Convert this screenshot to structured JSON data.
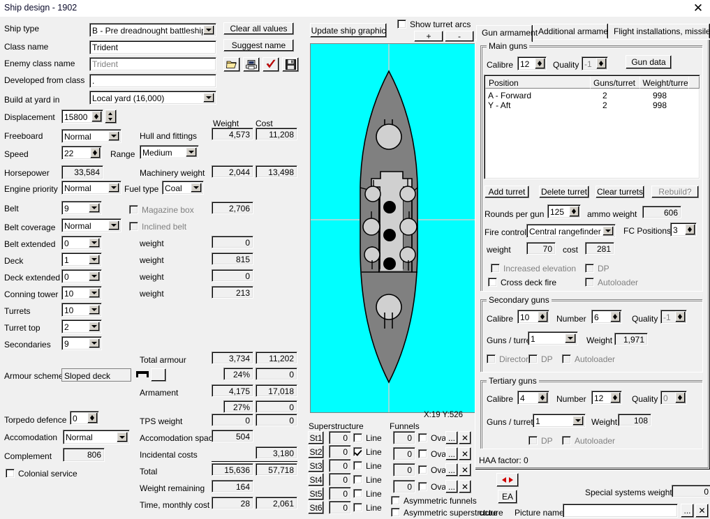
{
  "window": {
    "title": "Ship design - 1902",
    "close_label": "✕"
  },
  "left": {
    "fields": [
      {
        "label": "Ship type",
        "value": "B - Pre dreadnought battleship",
        "kind": "combo"
      },
      {
        "label": "Class name",
        "value": "Trident",
        "kind": "text"
      },
      {
        "label": "Enemy class name",
        "value": "Trident",
        "kind": "text-gray"
      },
      {
        "label": "Developed from class",
        "value": ".",
        "kind": "text"
      },
      {
        "label": "Build at yard in",
        "value": "Local yard (16,000)",
        "kind": "combo"
      },
      {
        "label": "Displacement",
        "value": "15800",
        "kind": "spin"
      },
      {
        "label": "Freeboard",
        "value": "Normal",
        "kind": "combo"
      },
      {
        "label": "Speed",
        "value": "22",
        "kind": "spin"
      },
      {
        "label": "Range",
        "value": "Medium",
        "kind": "combo"
      },
      {
        "label": "Horsepower",
        "value": "33,584",
        "kind": "readonly"
      },
      {
        "label": "Engine priority",
        "value": "Normal",
        "kind": "combo"
      },
      {
        "label": "Fuel type",
        "value": "Coal",
        "kind": "combo"
      },
      {
        "label": "Belt",
        "value": "9",
        "kind": "combo"
      },
      {
        "label": "Belt coverage",
        "value": "Normal",
        "kind": "combo"
      },
      {
        "label": "Belt extended",
        "value": "0",
        "kind": "combo"
      },
      {
        "label": "Deck",
        "value": "1",
        "kind": "combo"
      },
      {
        "label": "Deck extended",
        "value": "0",
        "kind": "combo"
      },
      {
        "label": "Conning tower",
        "value": "10",
        "kind": "combo"
      },
      {
        "label": "Turrets",
        "value": "10",
        "kind": "combo"
      },
      {
        "label": "Turret top",
        "value": "2",
        "kind": "combo"
      },
      {
        "label": "Secondaries",
        "value": "9",
        "kind": "combo"
      },
      {
        "label": "Armour scheme",
        "value": "Sloped deck",
        "kind": "readonly"
      },
      {
        "label": "Torpedo defence",
        "value": "0",
        "kind": "spin"
      },
      {
        "label": "Accomodation",
        "value": "Normal",
        "kind": "combo"
      },
      {
        "label": "Complement",
        "value": "806",
        "kind": "readonly"
      }
    ],
    "colonial_service": {
      "label": "Colonial service",
      "checked": false
    }
  },
  "weights": {
    "col_weight": "Weight",
    "col_cost": "Cost",
    "rows": [
      {
        "label": "Hull and fittings",
        "weight": "4,573",
        "cost": "11,208"
      },
      {
        "label": "Machinery weight",
        "weight": "2,044",
        "cost": "13,498"
      },
      {
        "label": "Magazine box",
        "weight": "2,706",
        "cost": "",
        "disabled": true
      },
      {
        "label": "Inclined belt",
        "weight": "",
        "cost": "",
        "disabled": true
      },
      {
        "label": "weight",
        "weight": "0",
        "cost": ""
      },
      {
        "label": "weight",
        "weight": "815",
        "cost": ""
      },
      {
        "label": "weight",
        "weight": "0",
        "cost": ""
      },
      {
        "label": "weight",
        "weight": "213",
        "cost": ""
      },
      {
        "label": "Total armour",
        "weight": "3,734",
        "cost": "11,202"
      },
      {
        "label": "",
        "weight": "24%",
        "cost": "0"
      },
      {
        "label": "Armament",
        "weight": "4,175",
        "cost": "17,018"
      },
      {
        "label": "",
        "weight": "27%",
        "cost": "0"
      },
      {
        "label": "TPS weight",
        "weight": "0",
        "cost": "0"
      },
      {
        "label": "Accomodation space",
        "weight": "504",
        "cost": ""
      },
      {
        "label": "Incidental costs",
        "weight": "",
        "cost": "3,180"
      },
      {
        "label": "Total",
        "weight": "15,636",
        "cost": "57,718"
      },
      {
        "label": "Weight remaining",
        "weight": "164",
        "cost": ""
      },
      {
        "label": "Time, monthly cost",
        "weight": "28",
        "cost": "2,061"
      }
    ]
  },
  "toolbar": {
    "clear_all_values": "Clear all values",
    "suggest_name": "Suggest name",
    "icons": [
      {
        "name": "open-folder-icon",
        "glyph": "📂"
      },
      {
        "name": "print-icon",
        "glyph": "🖥"
      },
      {
        "name": "validate-check-icon",
        "glyph": "✔"
      },
      {
        "name": "save-disk-icon",
        "glyph": "💾"
      }
    ]
  },
  "graphic": {
    "update_button": "Update ship graphic",
    "show_turret_arcs": {
      "label": "Show turret arcs",
      "checked": false
    },
    "zoom_in": "+",
    "zoom_out": "-",
    "coords": "X:19 Y:526",
    "bg_color": "#00ffff",
    "hull_color": "#808080",
    "deck_color": "#c0c0c0"
  },
  "superstructure": {
    "title": "Superstructure",
    "line_label": "Line",
    "rows": [
      {
        "button": "St1",
        "value": "0",
        "line": false
      },
      {
        "button": "St2",
        "value": "0",
        "line": true
      },
      {
        "button": "St3",
        "value": "0",
        "line": false
      },
      {
        "button": "St4",
        "value": "0",
        "line": false
      },
      {
        "button": "St5",
        "value": "0",
        "line": false
      },
      {
        "button": "St6",
        "value": "0",
        "line": false
      }
    ]
  },
  "funnels": {
    "title": "Funnels",
    "oval_label": "Oval",
    "browse_label": "...",
    "clear_label": "✕",
    "rows": [
      {
        "value": "0",
        "oval": false
      },
      {
        "value": "0",
        "oval": false
      },
      {
        "value": "0",
        "oval": false
      },
      {
        "value": "0",
        "oval": false
      }
    ],
    "asymmetric_funnels": {
      "label": "Asymmetric funnels",
      "checked": false
    },
    "asymmetric_superstructure": {
      "label": "Asymmetric superstructure",
      "checked": false
    }
  },
  "right": {
    "tabs": [
      {
        "label": "Gun armament",
        "active": true
      },
      {
        "label": "Additional armament",
        "active": false
      },
      {
        "label": "Flight installations, missiles",
        "active": false
      }
    ],
    "main_guns": {
      "title": "Main guns",
      "calibre_label": "Calibre",
      "calibre": "12",
      "quality_label": "Quality",
      "quality": "-1",
      "gun_data_button": "Gun data",
      "columns": [
        "Position",
        "Guns/turret",
        "Weight/turret"
      ],
      "rows": [
        {
          "position": "A - Forward",
          "guns": "2",
          "weight": "998"
        },
        {
          "position": "Y - Aft",
          "guns": "2",
          "weight": "998"
        }
      ],
      "add_turret": "Add turret",
      "delete_turret": "Delete turret",
      "clear_turrets": "Clear turrets",
      "rebuild": "Rebuild?",
      "rounds_per_gun_label": "Rounds per gun",
      "rounds_per_gun": "125",
      "ammo_weight_label": "ammo weight",
      "ammo_weight": "606",
      "fire_control_label": "Fire control",
      "fire_control": "Central rangefinder",
      "fc_positions_label": "FC Positions",
      "fc_positions": "3",
      "weight_label": "weight",
      "weight": "70",
      "cost_label": "cost",
      "cost": "281",
      "increased_elevation": {
        "label": "Increased elevation",
        "checked": false
      },
      "dp": {
        "label": "DP",
        "checked": false
      },
      "cross_deck_fire": {
        "label": "Cross deck fire",
        "checked": false
      },
      "autoloader": {
        "label": "Autoloader",
        "checked": false
      }
    },
    "secondary_guns": {
      "title": "Secondary guns",
      "calibre_label": "Calibre",
      "calibre": "10",
      "number_label": "Number",
      "number": "6",
      "quality_label": "Quality",
      "quality": "-1",
      "guns_per_turret_label": "Guns / turret",
      "guns_per_turret": "1",
      "weight_label": "Weight",
      "weight": "1,971",
      "director": {
        "label": "Director",
        "checked": false
      },
      "dp": {
        "label": "DP",
        "checked": false
      },
      "autoloader": {
        "label": "Autoloader",
        "checked": false
      }
    },
    "tertiary_guns": {
      "title": "Tertiary guns",
      "calibre_label": "Calibre",
      "calibre": "4",
      "number_label": "Number",
      "number": "12",
      "quality_label": "Quality",
      "quality": "0",
      "guns_per_turret_label": "Guns / turret",
      "guns_per_turret": "1",
      "weight_label": "Weight",
      "weight": "108",
      "dp": {
        "label": "DP",
        "checked": false
      },
      "autoloader": {
        "label": "Autoloader",
        "checked": false
      }
    },
    "haa_factor": "HAA factor: 0"
  },
  "bottom": {
    "flip_button": "◀▶",
    "ea_button": "EA",
    "picture_label": "cture",
    "special_systems_weight_label": "Special systems weight",
    "special_systems_weight": "0",
    "picture_name_label": "Picture name",
    "picture_name": "",
    "browse_label": "...",
    "clear_label": "✕"
  }
}
